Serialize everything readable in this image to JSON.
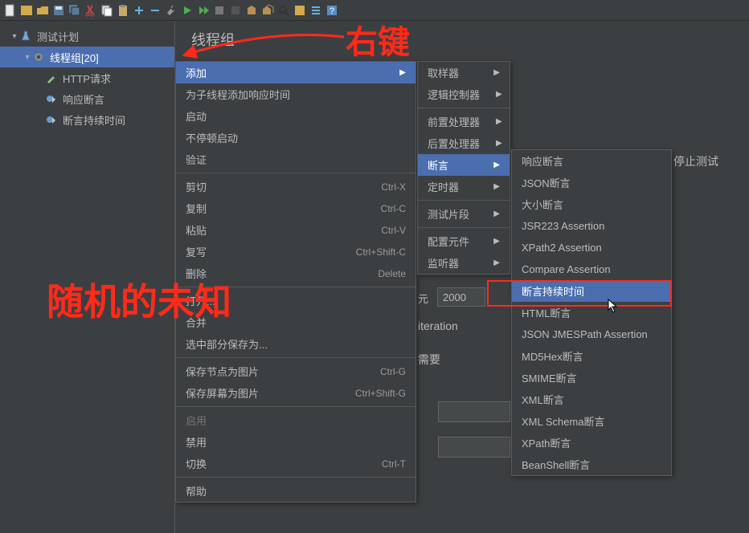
{
  "annotations": {
    "right_click": "右键",
    "random_unknown": "随机的未知"
  },
  "toolbar_icons": [
    "new",
    "open",
    "save",
    "save-all",
    "cut",
    "copy",
    "paste",
    "add",
    "minus",
    "wrench",
    "run-green",
    "run-fwd",
    "stop",
    "stop-all",
    "clear",
    "clear-all",
    "search",
    "fn",
    "list",
    "help"
  ],
  "tree": {
    "root": "测试计划",
    "thread_group": "线程组[20]",
    "children": [
      "HTTP请求",
      "响应断言",
      "断言持续时间"
    ]
  },
  "content": {
    "title": "线程组",
    "e_label": "元",
    "e_value": "2000",
    "iteration": "iteration",
    "need": "需要",
    "stop_test_partial": "停止测试"
  },
  "menu1": [
    {
      "label": "添加",
      "hl": true,
      "arrow": true
    },
    {
      "label": "为子线程添加响应时间"
    },
    {
      "label": "启动"
    },
    {
      "label": "不停顿启动"
    },
    {
      "label": "验证"
    },
    {
      "sep": true
    },
    {
      "label": "剪切",
      "shortcut": "Ctrl-X"
    },
    {
      "label": "复制",
      "shortcut": "Ctrl-C"
    },
    {
      "label": "粘贴",
      "shortcut": "Ctrl-V"
    },
    {
      "label": "复写",
      "shortcut": "Ctrl+Shift-C"
    },
    {
      "label": "删除",
      "shortcut": "Delete"
    },
    {
      "sep": true
    },
    {
      "label": "打开..."
    },
    {
      "label": "合并"
    },
    {
      "label": "选中部分保存为..."
    },
    {
      "sep": true
    },
    {
      "label": "保存节点为图片",
      "shortcut": "Ctrl-G"
    },
    {
      "label": "保存屏幕为图片",
      "shortcut": "Ctrl+Shift-G"
    },
    {
      "sep": true
    },
    {
      "label": "启用",
      "disabled": true
    },
    {
      "label": "禁用"
    },
    {
      "label": "切换",
      "shortcut": "Ctrl-T"
    },
    {
      "sep": true
    },
    {
      "label": "帮助"
    }
  ],
  "menu2": [
    {
      "label": "取样器",
      "arrow": true
    },
    {
      "label": "逻辑控制器",
      "arrow": true
    },
    {
      "sep": true
    },
    {
      "label": "前置处理器",
      "arrow": true
    },
    {
      "label": "后置处理器",
      "arrow": true
    },
    {
      "label": "断言",
      "hl": true,
      "arrow": true
    },
    {
      "label": "定时器",
      "arrow": true
    },
    {
      "sep": true
    },
    {
      "label": "测试片段",
      "arrow": true
    },
    {
      "sep": true
    },
    {
      "label": "配置元件",
      "arrow": true
    },
    {
      "label": "监听器",
      "arrow": true
    }
  ],
  "menu3": [
    {
      "label": "响应断言"
    },
    {
      "label": "JSON断言"
    },
    {
      "label": "大小断言"
    },
    {
      "label": "JSR223 Assertion"
    },
    {
      "label": "XPath2 Assertion"
    },
    {
      "label": "Compare Assertion"
    },
    {
      "label": "断言持续时间",
      "hl": true
    },
    {
      "label": "HTML断言"
    },
    {
      "label": "JSON JMESPath Assertion"
    },
    {
      "label": "MD5Hex断言"
    },
    {
      "label": "SMIME断言"
    },
    {
      "label": "XML断言"
    },
    {
      "label": "XML Schema断言"
    },
    {
      "label": "XPath断言"
    },
    {
      "label": "BeanShell断言"
    }
  ]
}
